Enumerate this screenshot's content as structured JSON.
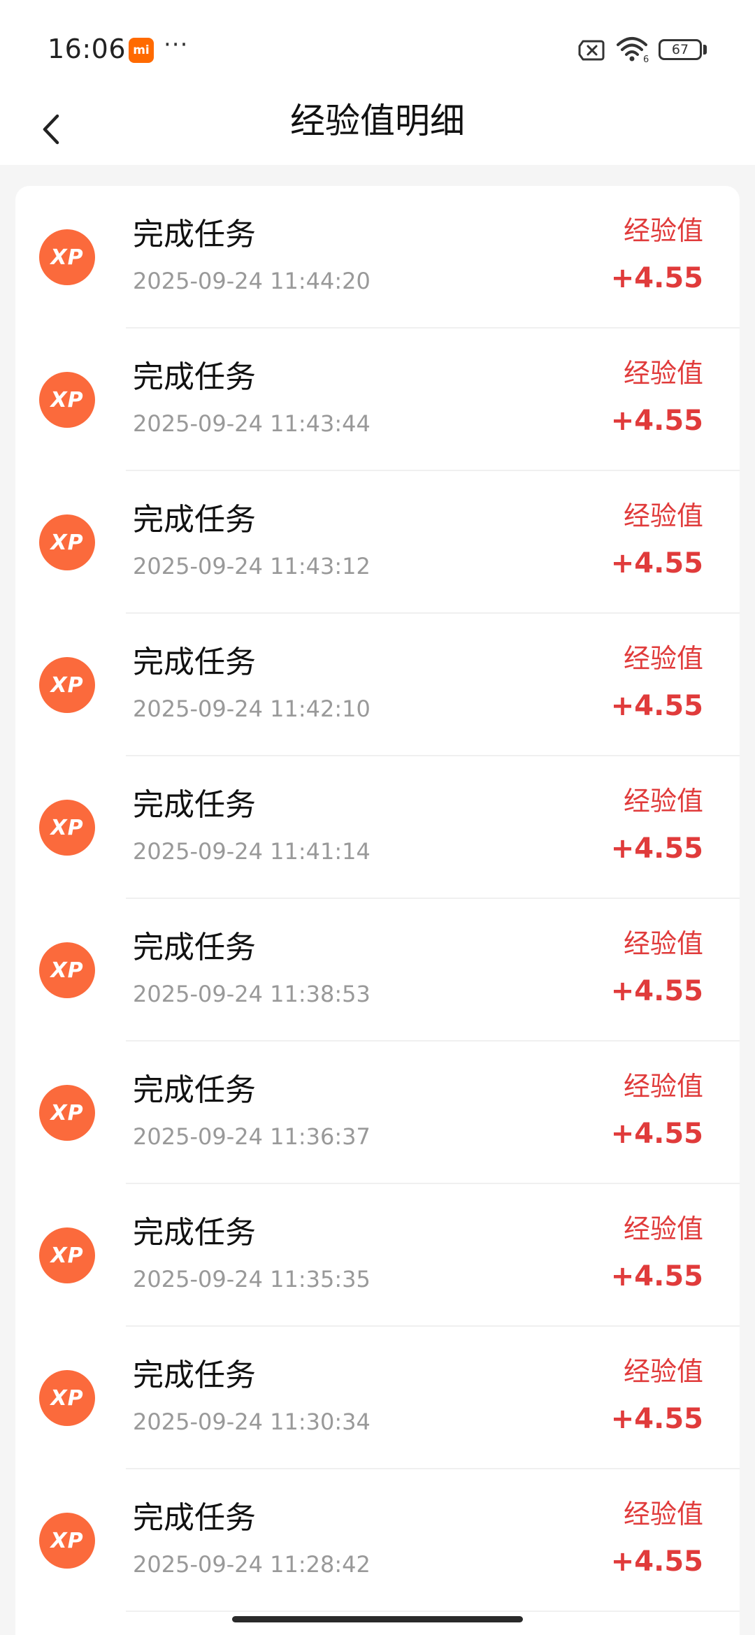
{
  "status_bar": {
    "time": "16:06",
    "app_badge": "mi",
    "more": "···",
    "battery_level": "67"
  },
  "header": {
    "back_icon": "chevron-left-icon",
    "title": "经验值明细"
  },
  "colors": {
    "accent": "#e03b3b",
    "icon_bg": "#fb6a3c",
    "badge": "#ff6a00"
  },
  "records": [
    {
      "icon_label": "XP",
      "title": "完成任务",
      "time": "2025-09-24 11:44:20",
      "type": "经验值",
      "amount": "+4.55"
    },
    {
      "icon_label": "XP",
      "title": "完成任务",
      "time": "2025-09-24 11:43:44",
      "type": "经验值",
      "amount": "+4.55"
    },
    {
      "icon_label": "XP",
      "title": "完成任务",
      "time": "2025-09-24 11:43:12",
      "type": "经验值",
      "amount": "+4.55"
    },
    {
      "icon_label": "XP",
      "title": "完成任务",
      "time": "2025-09-24 11:42:10",
      "type": "经验值",
      "amount": "+4.55"
    },
    {
      "icon_label": "XP",
      "title": "完成任务",
      "time": "2025-09-24 11:41:14",
      "type": "经验值",
      "amount": "+4.55"
    },
    {
      "icon_label": "XP",
      "title": "完成任务",
      "time": "2025-09-24 11:38:53",
      "type": "经验值",
      "amount": "+4.55"
    },
    {
      "icon_label": "XP",
      "title": "完成任务",
      "time": "2025-09-24 11:36:37",
      "type": "经验值",
      "amount": "+4.55"
    },
    {
      "icon_label": "XP",
      "title": "完成任务",
      "time": "2025-09-24 11:35:35",
      "type": "经验值",
      "amount": "+4.55"
    },
    {
      "icon_label": "XP",
      "title": "完成任务",
      "time": "2025-09-24 11:30:34",
      "type": "经验值",
      "amount": "+4.55"
    },
    {
      "icon_label": "XP",
      "title": "完成任务",
      "time": "2025-09-24 11:28:42",
      "type": "经验值",
      "amount": "+4.55"
    }
  ]
}
